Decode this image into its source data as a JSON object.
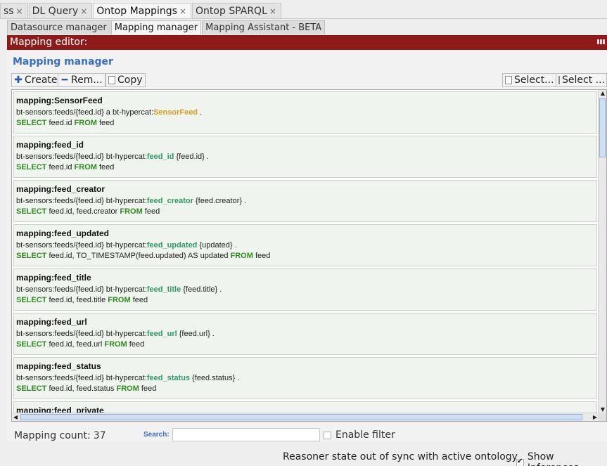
{
  "top_tabs": [
    {
      "label": "ss",
      "active": false
    },
    {
      "label": "DL Query",
      "active": false
    },
    {
      "label": "Ontop Mappings",
      "active": true
    },
    {
      "label": "Ontop SPARQL",
      "active": false
    }
  ],
  "close_glyph": "×",
  "sub_tabs": [
    {
      "label": "Datasource manager",
      "active": false
    },
    {
      "label": "Mapping manager",
      "active": true
    },
    {
      "label": "Mapping Assistant - BETA",
      "active": false
    }
  ],
  "editor_title": "Mapping editor:",
  "panel_title": "Mapping manager",
  "toolbar": {
    "create_label": "Create",
    "remove_label": "Rem...",
    "copy_label": "Copy",
    "select_all_label": "Select...",
    "select_none_label": "Select ..."
  },
  "mappings": [
    {
      "id": "mapping:SensorFeed",
      "target_pre": "bt-sensors:feeds/{feed.id} a bt-hypercat:",
      "predicate": "SensorFeed",
      "target_post": " .",
      "is_class": true,
      "select_kw": "SELECT",
      "select_cols": " feed.id ",
      "from_kw": "FROM",
      "from_tail": " feed"
    },
    {
      "id": "mapping:feed_id",
      "target_pre": "bt-sensors:feeds/{feed.id} bt-hypercat:",
      "predicate": "feed_id",
      "target_post": " {feed.id} .",
      "is_class": false,
      "select_kw": "SELECT",
      "select_cols": " feed.id ",
      "from_kw": "FROM",
      "from_tail": " feed"
    },
    {
      "id": "mapping:feed_creator",
      "target_pre": "bt-sensors:feeds/{feed.id} bt-hypercat:",
      "predicate": "feed_creator",
      "target_post": " {feed.creator} .",
      "is_class": false,
      "select_kw": "SELECT",
      "select_cols": " feed.id, feed.creator ",
      "from_kw": "FROM",
      "from_tail": " feed"
    },
    {
      "id": "mapping:feed_updated",
      "target_pre": "bt-sensors:feeds/{feed.id} bt-hypercat:",
      "predicate": "feed_updated",
      "target_post": " {updated} .",
      "is_class": false,
      "select_kw": "SELECT",
      "select_cols": " feed.id, TO_TIMESTAMP(feed.updated) AS updated ",
      "from_kw": "FROM",
      "from_tail": " feed"
    },
    {
      "id": "mapping:feed_title",
      "target_pre": "bt-sensors:feeds/{feed.id} bt-hypercat:",
      "predicate": "feed_title",
      "target_post": " {feed.title} .",
      "is_class": false,
      "select_kw": "SELECT",
      "select_cols": " feed.id, feed.title ",
      "from_kw": "FROM",
      "from_tail": " feed"
    },
    {
      "id": "mapping:feed_url",
      "target_pre": "bt-sensors:feeds/{feed.id} bt-hypercat:",
      "predicate": "feed_url",
      "target_post": " {feed.url} .",
      "is_class": false,
      "select_kw": "SELECT",
      "select_cols": " feed.id, feed.url ",
      "from_kw": "FROM",
      "from_tail": " feed"
    },
    {
      "id": "mapping:feed_status",
      "target_pre": "bt-sensors:feeds/{feed.id} bt-hypercat:",
      "predicate": "feed_status",
      "target_post": " {feed.status} .",
      "is_class": false,
      "select_kw": "SELECT",
      "select_cols": " feed.id, feed.status ",
      "from_kw": "FROM",
      "from_tail": " feed"
    },
    {
      "id": "mapping:feed_private",
      "target_pre": "",
      "predicate": "",
      "target_post": "",
      "is_class": false,
      "select_kw": "",
      "select_cols": "",
      "from_kw": "",
      "from_tail": ""
    }
  ],
  "footer": {
    "count_label": "Mapping count:",
    "count_value": "37",
    "search_label": "Search:",
    "search_value": "",
    "filter_label": "Enable filter",
    "filter_checked": false
  },
  "status": {
    "message": "Reasoner state out of sync with active ontology",
    "show_inferences_label": "Show Inferences",
    "show_inferences_checked": true
  },
  "colors": {
    "editor_bar": "#8e1a1a",
    "panel_title": "#3a6fc1",
    "property_predicate": "#2d9a68",
    "class_predicate": "#d59b22",
    "sql_keyword": "#2e8b1e"
  }
}
